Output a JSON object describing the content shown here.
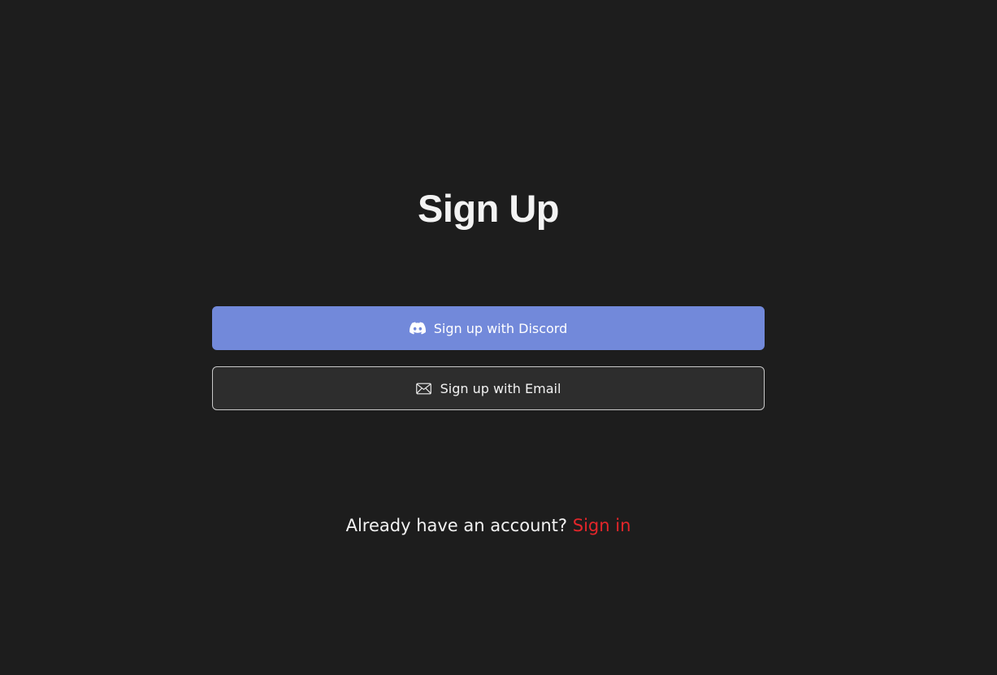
{
  "page": {
    "title": "Sign Up"
  },
  "buttons": {
    "discord": {
      "label": "Sign up with Discord",
      "icon": "discord-icon",
      "color": "#7289da"
    },
    "email": {
      "label": "Sign up with Email",
      "icon": "mail-icon",
      "color": "#2d2d2d"
    }
  },
  "footer": {
    "prompt": "Already have an account?",
    "link_label": "Sign in",
    "link_color": "#e3262a"
  },
  "theme": {
    "background": "#1d1d1d",
    "text": "#f2f2f2"
  }
}
